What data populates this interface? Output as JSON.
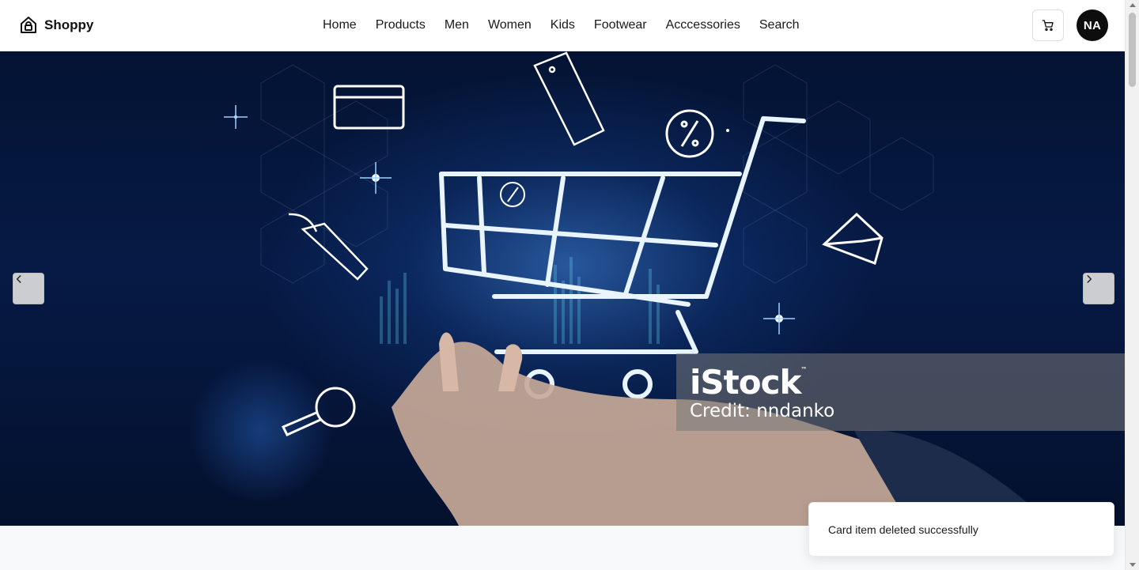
{
  "brand": {
    "name": "Shoppy",
    "icon": "shopping-bag-home-icon"
  },
  "nav": {
    "items": [
      {
        "label": "Home"
      },
      {
        "label": "Products"
      },
      {
        "label": "Men"
      },
      {
        "label": "Women"
      },
      {
        "label": "Kids"
      },
      {
        "label": "Footwear"
      },
      {
        "label": "Acccessories"
      },
      {
        "label": "Search"
      }
    ]
  },
  "header": {
    "cart_icon": "cart-icon",
    "avatar_initials": "NA"
  },
  "hero": {
    "prev_icon": "chevron-left-icon",
    "next_icon": "chevron-right-icon",
    "watermark": {
      "logo": "iStock",
      "tm": "™",
      "credit": "Credit: nndanko"
    }
  },
  "toast": {
    "message": "Card item deleted successfully"
  },
  "colors": {
    "header_bg": "#ffffff",
    "hero_bg": "#061a45",
    "accent_glow": "#3e80d6",
    "avatar_bg": "#0d0d0d"
  }
}
